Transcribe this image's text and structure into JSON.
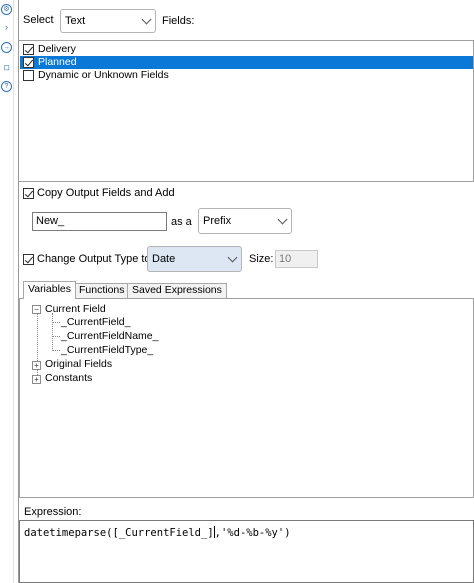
{
  "rail": {
    "icons": [
      "gear-icon",
      "chevron-right-icon",
      "arrow-icon",
      "tag-icon",
      "question-icon"
    ]
  },
  "select": {
    "label": "Select",
    "value": "Text",
    "fields_label": "Fields:"
  },
  "fields": [
    {
      "label": "Delivery",
      "checked": true,
      "selected": false
    },
    {
      "label": "Planned",
      "checked": true,
      "selected": true
    },
    {
      "label": "Dynamic or Unknown Fields",
      "checked": false,
      "selected": false
    }
  ],
  "copy_output": {
    "label": "Copy Output Fields and Add",
    "checked": true
  },
  "prefix": {
    "input_value": "New_",
    "as_a_label": "as a",
    "mode_value": "Prefix"
  },
  "change_type": {
    "label": "Change Output Type to",
    "checked": true,
    "type_value": "Date",
    "size_label": "Size:",
    "size_value": "10"
  },
  "tabs": [
    {
      "label": "Variables",
      "active": true
    },
    {
      "label": "Functions",
      "active": false
    },
    {
      "label": "Saved Expressions",
      "active": false
    }
  ],
  "tree": {
    "current_field": "Current Field",
    "current_field_children": [
      "_CurrentField_",
      "_CurrentFieldName_",
      "_CurrentFieldType_"
    ],
    "original_fields": "Original Fields",
    "constants": "Constants"
  },
  "expression": {
    "label": "Expression:",
    "before_caret": "datetimeparse([_CurrentField_]",
    "after_caret": ",'%d-%b-%y')"
  }
}
